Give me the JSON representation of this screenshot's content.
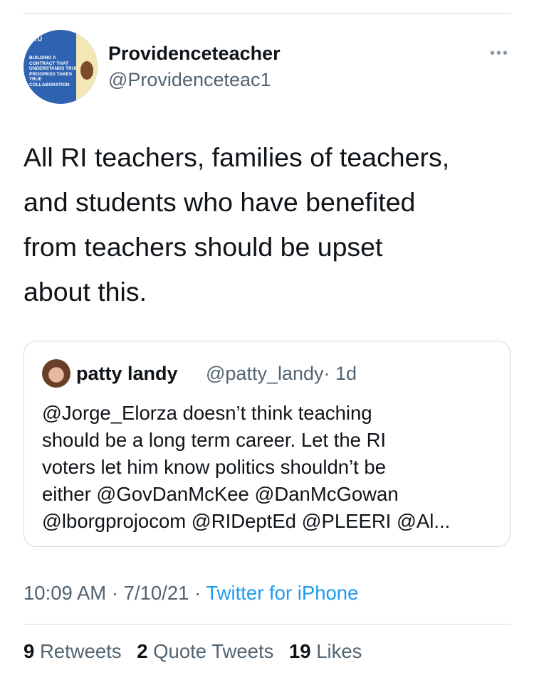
{
  "author": {
    "display_name": "Providenceteacher",
    "handle": "@Providenceteac1",
    "avatar_text": "BUILDING A CONTRACT THAT UNDERSTANDS TRUE PROGRESS TAKES TRUE COLLABORATION"
  },
  "tweet": {
    "text": "All RI teachers, families of teachers,\nand students who have benefited\nfrom teachers should be upset\nabout this."
  },
  "quoted": {
    "display_name": "patty landy",
    "handle": "@patty_landy",
    "age": "· 1d",
    "text": "@Jorge_Elorza doesn’t think teaching\nshould be a long term career. Let the RI\nvoters let him know politics shouldn’t be\neither @GovDanMcKee @DanMcGowan\n@lborgprojocom @RIDeptEd @PLEERI @Al..."
  },
  "meta": {
    "time": "10:09 AM",
    "date": "7/10/21",
    "separator": "·",
    "source": "Twitter for iPhone"
  },
  "stats": {
    "retweets_count": "9",
    "retweets_label": "Retweets",
    "quotes_count": "2",
    "quotes_label": "Quote Tweets",
    "likes_count": "19",
    "likes_label": "Likes"
  },
  "icons": {
    "more": "more-horizontal-icon"
  }
}
